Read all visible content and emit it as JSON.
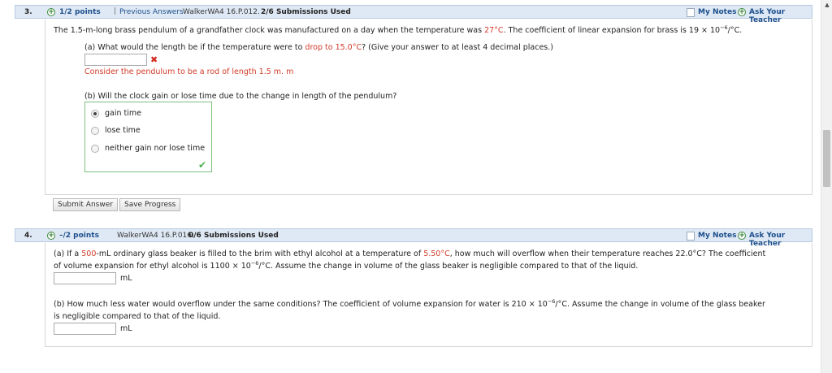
{
  "q3": {
    "number": "3.",
    "points": "1/2 points",
    "separator": "|",
    "previous_answers": "Previous Answers",
    "code": "WalkerWA4 16.P.012.",
    "submissions": "2/6 Submissions Used",
    "my_notes": "My Notes",
    "ask_teacher": "Ask Your Teacher",
    "prompt_p1": "The 1.5-m-long brass pendulum of a grandfather clock was manufactured on a day when the temperature was ",
    "prompt_temp": "27°C",
    "prompt_p2": ". The coefficient of linear expansion for brass is  19 × 10",
    "prompt_exp": "−6",
    "prompt_p3": "/°C.",
    "part_a_p1": "(a) What would the length be if the temperature were to ",
    "part_a_drop": "drop to 15.0°C",
    "part_a_p2": "? (Give your answer to at least 4 decimal places.)",
    "part_a_value": "",
    "hint": "Consider the pendulum to be a rod of length 1.5 m. m",
    "part_b": "(b) Will the clock gain or lose time due to the change in length of the pendulum?",
    "options": [
      "gain time",
      "lose time",
      "neither gain nor lose time"
    ],
    "selected_option": "gain time",
    "submit_label": "Submit Answer",
    "save_label": "Save Progress"
  },
  "q4": {
    "number": "4.",
    "points": "–/2 points",
    "code": "WalkerWA4 16.P.016.",
    "submissions": "0/6 Submissions Used",
    "my_notes": "My Notes",
    "ask_teacher": "Ask Your Teacher",
    "part_a_p1": "(a) If a ",
    "part_a_vol": "500",
    "part_a_p2": "-mL ordinary glass beaker is filled to the brim with ethyl alcohol at a temperature of ",
    "part_a_temp": "5.50°C",
    "part_a_p3": ", how much will overflow when their temperature reaches 22.0°C? The coefficient",
    "part_a_line2a": "of volume expansion for ethyl alcohol is  1100 × 10",
    "part_a_exp": "−6",
    "part_a_line2b": "/°C.  Assume the change in volume of the glass beaker is negligible compared to that of the liquid.",
    "part_a_value": "",
    "part_a_unit": "mL",
    "part_b_line1a": "(b) How much less water would overflow under the same conditions? The coefficient of volume expansion for water is  210 × 10",
    "part_b_exp": "−6",
    "part_b_line1b": "/°C.  Assume the change in volume of the glass beaker",
    "part_b_line2": "is negligible compared to that of the liquid.",
    "part_b_value": "",
    "part_b_unit": "mL"
  },
  "colors": {
    "header_bg": "#dfe9f5",
    "link": "#1d4f8c",
    "error_red": "#d23b2a",
    "correct_green": "#4caf50"
  },
  "icons": {
    "plus": "plus-circle-icon",
    "notes": "notes-checkbox-icon",
    "incorrect": "x-mark-icon",
    "correct": "check-mark-icon"
  }
}
